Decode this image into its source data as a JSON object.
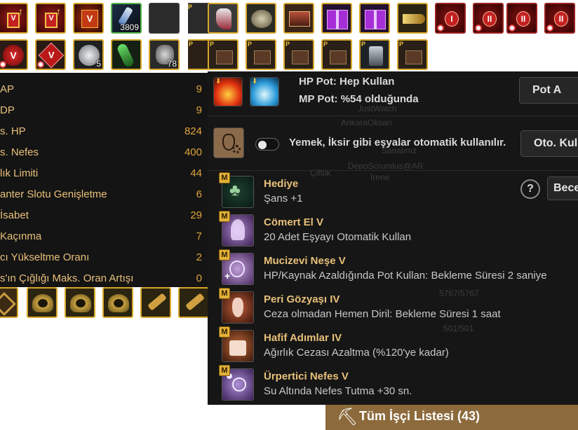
{
  "inventory": {
    "row1": [
      {
        "name": "v-scroll-icon",
        "badge": "V",
        "count": ""
      },
      {
        "name": "v-scroll-icon",
        "badge": "V",
        "count": ""
      },
      {
        "name": "v-rune-icon",
        "badge": "V",
        "count": ""
      },
      {
        "name": "blue-elixir-icon",
        "badge": "",
        "count": "3809"
      },
      {
        "name": "empty-slot",
        "badge": "",
        "count": ""
      },
      {
        "name": "tool-icon",
        "badge": "",
        "count": ""
      },
      {
        "name": "shoe-icon",
        "badge": "",
        "count": ""
      },
      {
        "name": "helmet-icon",
        "badge": "",
        "count": ""
      },
      {
        "name": "chest-icon",
        "badge": "",
        "count": ""
      },
      {
        "name": "gift-box-icon",
        "badge": "",
        "count": ""
      },
      {
        "name": "gift-box-icon",
        "badge": "",
        "count": ""
      },
      {
        "name": "horn-icon",
        "badge": "",
        "count": ""
      },
      {
        "name": "rune-I-icon",
        "badge": "I",
        "count": ""
      },
      {
        "name": "rune-II-icon",
        "badge": "II",
        "count": ""
      },
      {
        "name": "rune-II-icon",
        "badge": "II",
        "count": ""
      },
      {
        "name": "rune-II-icon",
        "badge": "II",
        "count": ""
      }
    ],
    "row2": [
      {
        "name": "red-v-orb-icon",
        "badge": "V",
        "count": ""
      },
      {
        "name": "red-v-gem-icon",
        "badge": "V",
        "count": ""
      },
      {
        "name": "silver-orb-icon",
        "badge": "",
        "count": "5"
      },
      {
        "name": "green-feather-icon",
        "badge": "",
        "count": ""
      },
      {
        "name": "skull-icon",
        "badge": "",
        "count": "78"
      },
      {
        "name": "chest-icon",
        "badge": "",
        "count": ""
      },
      {
        "name": "chest-icon",
        "badge": "",
        "count": ""
      },
      {
        "name": "chest-icon",
        "badge": "",
        "count": ""
      },
      {
        "name": "chest-icon",
        "badge": "",
        "count": ""
      },
      {
        "name": "chest-icon",
        "badge": "",
        "count": ""
      },
      {
        "name": "armor-icon",
        "badge": "",
        "count": ""
      },
      {
        "name": "chest-icon",
        "badge": "",
        "count": ""
      }
    ]
  },
  "stats": [
    {
      "label": "AP",
      "value": "9"
    },
    {
      "label": "DP",
      "value": "9"
    },
    {
      "label": "s. HP",
      "value": "824"
    },
    {
      "label": "s. Nefes",
      "value": "400"
    },
    {
      "label": "lık Limiti",
      "value": "44"
    },
    {
      "label": "anter Slotu Genişletme",
      "value": "6"
    },
    {
      "label": " İsabet",
      "value": "29"
    },
    {
      "label": " Kaçınma",
      "value": "7"
    },
    {
      "label": "cı Yükseltme Oranı",
      "value": "2"
    },
    {
      "label": "s'ın Çığlığı Maks. Oran Artışı",
      "value": "0"
    }
  ],
  "pots": {
    "hp_line": "HP Pot: Hep Kullan",
    "mp_line": "MP Pot: %54 olduğunda",
    "button": "Pot A"
  },
  "food": {
    "text": "Yemek, İksir gibi eşyalar otomatik kullanılır.",
    "button": "Oto. Kull"
  },
  "skills_button": "Bece",
  "help_label": "?",
  "skill_badge": "M",
  "skills": [
    {
      "name": "Hediye",
      "desc": "Şans +1",
      "icon": "clover-icon"
    },
    {
      "name": "Cömert El V",
      "desc": "20 Adet Eşyayı Otomatik Kullan",
      "icon": "fairy-icon"
    },
    {
      "name": "Mucizevi Neşe V",
      "desc": "HP/Kaynak Azaldığında Pot Kullan: Bekleme Süresi 2 saniye",
      "icon": "potion-plus-icon"
    },
    {
      "name": "Peri Gözyaşı IV",
      "desc": "Ceza olmadan Hemen Diril: Bekleme Süresi 1 saat",
      "icon": "tear-vial-icon"
    },
    {
      "name": "Hafif Adımlar IV",
      "desc": "Ağırlık Cezası Azaltma (%120'ye kadar)",
      "icon": "weight-icon"
    },
    {
      "name": "Ürpertici Nefes V",
      "desc": "Su Altında Nefes Tutma +30 sn.",
      "icon": "breath-timer-icon"
    }
  ],
  "background_text": [
    "JustWatch",
    "AnkaraOksan",
    "Sanalınız",
    "DepoScrumlus@AR",
    "Çiftlik",
    "İrene",
    "5767/5767",
    "501/501"
  ],
  "worker": {
    "label": "Tüm İşçi Listesi (43)"
  },
  "colors": {
    "accent_gold": "#e3b038",
    "stat_label": "#e8c07a",
    "panel_bg": "#161616",
    "worker_bar": "#8c6a3c"
  }
}
